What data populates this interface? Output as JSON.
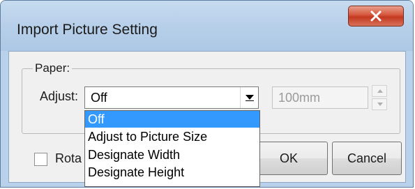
{
  "dialog": {
    "title": "Import Picture Setting",
    "close_icon": "close-x-icon"
  },
  "paper_group": {
    "label": "Paper:",
    "adjust_label": "Adjust:",
    "adjust_value": "Off",
    "size_value": "100mm"
  },
  "dropdown": {
    "options": [
      "Off",
      "Adjust to Picture Size",
      "Designate Width",
      "Designate Height"
    ],
    "selected_index": 0
  },
  "rotate": {
    "label": "Rota",
    "checked": false
  },
  "buttons": {
    "ok": "OK",
    "cancel": "Cancel"
  },
  "colors": {
    "selection": "#3399ff",
    "close_button": "#c2391f"
  }
}
